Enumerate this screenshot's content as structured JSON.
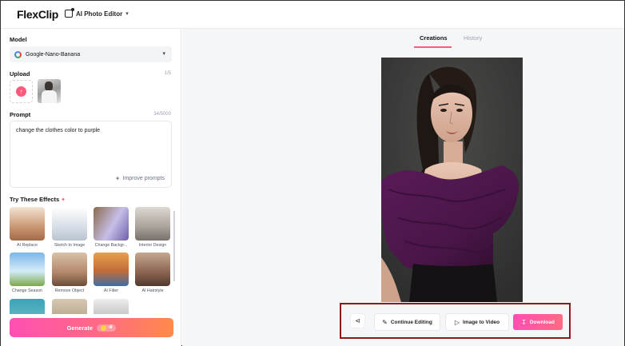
{
  "header": {
    "logo_text": "FlexClip",
    "editor_menu": "AI Photo Editor"
  },
  "sidebar": {
    "model_title": "Model",
    "model_value": "Google-Nano-Banana",
    "upload_title": "Upload",
    "upload_count": "1/5",
    "prompt_title": "Prompt",
    "prompt_count": "34/5000",
    "prompt_value": "change the clothes color to purple",
    "improve_label": "Improve prompts",
    "effects_title": "Try These Effects",
    "effects": [
      {
        "label": "AI Replace"
      },
      {
        "label": "Sketch to Image"
      },
      {
        "label": "Change Backgr..."
      },
      {
        "label": "Interior Design"
      },
      {
        "label": "Change Season"
      },
      {
        "label": "Remove Object"
      },
      {
        "label": "AI Filter"
      },
      {
        "label": "AI Hairstyle"
      },
      {
        "label": ""
      },
      {
        "label": ""
      },
      {
        "label": ""
      }
    ],
    "generate_label": "Generate",
    "generate_cost": "-8"
  },
  "main": {
    "tabs": [
      {
        "label": "Creations",
        "active": true
      },
      {
        "label": "History",
        "active": false
      }
    ],
    "actions": {
      "continue_label": "Continue Editing",
      "video_label": "Image to Video",
      "download_label": "Download"
    }
  },
  "colors": {
    "accent": "#ff5a7e",
    "outfit": "#4a1648",
    "highlight_frame": "#8b1a1a"
  }
}
